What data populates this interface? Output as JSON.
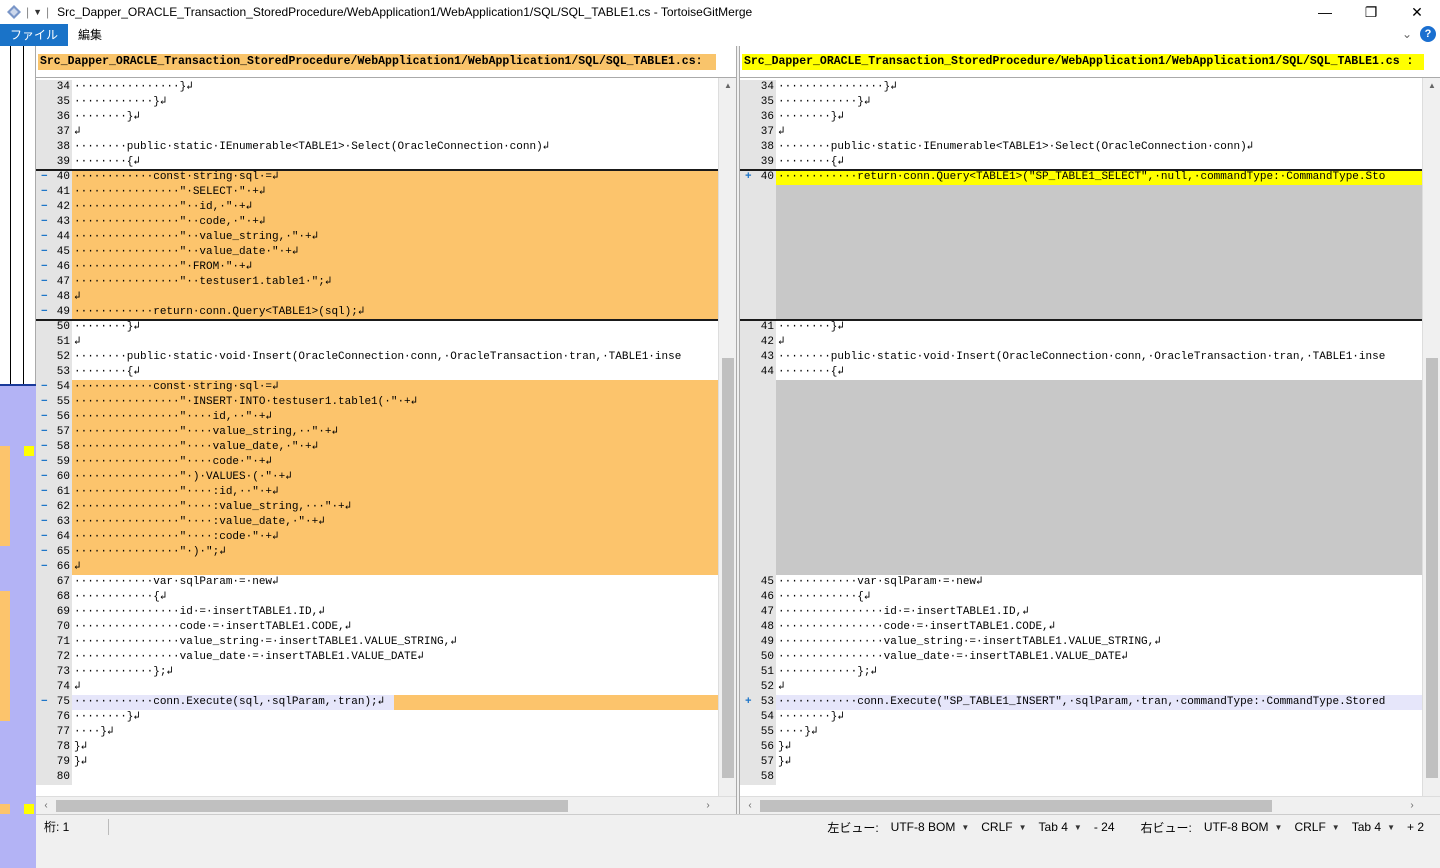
{
  "window": {
    "title": "Src_Dapper_ORACLE_Transaction_StoredProcedure/WebApplication1/WebApplication1/SQL/SQL_TABLE1.cs - TortoiseGitMerge",
    "minimize": "—",
    "maximize": "❐",
    "close": "✕"
  },
  "menu": {
    "file": "ファイル",
    "edit": "編集",
    "chevron_icon": "chevron-down-icon",
    "help_label": "?"
  },
  "left_pane": {
    "header": "Src_Dapper_ORACLE_Transaction_StoredProcedure/WebApplication1/WebApplication1/SQL/SQL_TABLE1.cs:",
    "lines": [
      {
        "num": "34",
        "mark": "",
        "type": "normal",
        "text": "················}↲"
      },
      {
        "num": "35",
        "mark": "",
        "type": "normal",
        "text": "············}↲"
      },
      {
        "num": "36",
        "mark": "",
        "type": "normal",
        "text": "········}↲"
      },
      {
        "num": "37",
        "mark": "",
        "type": "normal",
        "text": "↲"
      },
      {
        "num": "38",
        "mark": "",
        "type": "normal",
        "text": "········public·static·IEnumerable<TABLE1>·Select(OracleConnection·conn)↲"
      },
      {
        "num": "39",
        "mark": "",
        "type": "normal",
        "text": "········{↲"
      },
      {
        "num": "40",
        "mark": "−",
        "type": "removed",
        "text": "············const·string·sql·=↲"
      },
      {
        "num": "41",
        "mark": "−",
        "type": "removed",
        "text": "················\"·SELECT·\"·+↲"
      },
      {
        "num": "42",
        "mark": "−",
        "type": "removed",
        "text": "················\"··id,·\"·+↲"
      },
      {
        "num": "43",
        "mark": "−",
        "type": "removed",
        "text": "················\"··code,·\"·+↲"
      },
      {
        "num": "44",
        "mark": "−",
        "type": "removed",
        "text": "················\"··value_string,·\"·+↲"
      },
      {
        "num": "45",
        "mark": "−",
        "type": "removed",
        "text": "················\"··value_date·\"·+↲"
      },
      {
        "num": "46",
        "mark": "−",
        "type": "removed",
        "text": "················\"·FROM·\"·+↲"
      },
      {
        "num": "47",
        "mark": "−",
        "type": "removed",
        "text": "················\"··testuser1.table1·\";↲"
      },
      {
        "num": "48",
        "mark": "−",
        "type": "removed",
        "text": "↲"
      },
      {
        "num": "49",
        "mark": "−",
        "type": "removed",
        "text": "············return·conn.Query<TABLE1>(sql);↲"
      },
      {
        "num": "50",
        "mark": "",
        "type": "normal",
        "text": "········}↲"
      },
      {
        "num": "51",
        "mark": "",
        "type": "normal",
        "text": "↲"
      },
      {
        "num": "52",
        "mark": "",
        "type": "normal",
        "text": "········public·static·void·Insert(OracleConnection·conn,·OracleTransaction·tran,·TABLE1·inse"
      },
      {
        "num": "53",
        "mark": "",
        "type": "normal",
        "text": "········{↲"
      },
      {
        "num": "54",
        "mark": "−",
        "type": "removed",
        "text": "············const·string·sql·=↲"
      },
      {
        "num": "55",
        "mark": "−",
        "type": "removed",
        "text": "················\"·INSERT·INTO·testuser1.table1(·\"·+↲"
      },
      {
        "num": "56",
        "mark": "−",
        "type": "removed",
        "text": "················\"····id,··\"·+↲"
      },
      {
        "num": "57",
        "mark": "−",
        "type": "removed",
        "text": "················\"····value_string,··\"·+↲"
      },
      {
        "num": "58",
        "mark": "−",
        "type": "removed",
        "text": "················\"····value_date,·\"·+↲"
      },
      {
        "num": "59",
        "mark": "−",
        "type": "removed",
        "text": "················\"····code·\"·+↲"
      },
      {
        "num": "60",
        "mark": "−",
        "type": "removed",
        "text": "················\"·)·VALUES·(·\"·+↲"
      },
      {
        "num": "61",
        "mark": "−",
        "type": "removed",
        "text": "················\"····:id,··\"·+↲"
      },
      {
        "num": "62",
        "mark": "−",
        "type": "removed",
        "text": "················\"····:value_string,···\"·+↲"
      },
      {
        "num": "63",
        "mark": "−",
        "type": "removed",
        "text": "················\"····:value_date,·\"·+↲"
      },
      {
        "num": "64",
        "mark": "−",
        "type": "removed",
        "text": "················\"····:code·\"·+↲"
      },
      {
        "num": "65",
        "mark": "−",
        "type": "removed",
        "text": "················\"·)·\";↲"
      },
      {
        "num": "66",
        "mark": "−",
        "type": "removed",
        "text": "↲"
      },
      {
        "num": "67",
        "mark": "",
        "type": "normal",
        "text": "············var·sqlParam·=·new↲"
      },
      {
        "num": "68",
        "mark": "",
        "type": "normal",
        "text": "············{↲"
      },
      {
        "num": "69",
        "mark": "",
        "type": "normal",
        "text": "················id·=·insertTABLE1.ID,↲"
      },
      {
        "num": "70",
        "mark": "",
        "type": "normal",
        "text": "················code·=·insertTABLE1.CODE,↲"
      },
      {
        "num": "71",
        "mark": "",
        "type": "normal",
        "text": "················value_string·=·insertTABLE1.VALUE_STRING,↲"
      },
      {
        "num": "72",
        "mark": "",
        "type": "normal",
        "text": "················value_date·=·insertTABLE1.VALUE_DATE↲"
      },
      {
        "num": "73",
        "mark": "",
        "type": "normal",
        "text": "············};↲"
      },
      {
        "num": "74",
        "mark": "",
        "type": "normal",
        "text": "↲"
      },
      {
        "num": "75",
        "mark": "−",
        "type": "cursor-removed",
        "text": "············conn.Execute(sql,·sqlParam,·tran);↲"
      },
      {
        "num": "76",
        "mark": "",
        "type": "normal",
        "text": "········}↲"
      },
      {
        "num": "77",
        "mark": "",
        "type": "normal",
        "text": "····}↲"
      },
      {
        "num": "78",
        "mark": "",
        "type": "normal",
        "text": "}↲"
      },
      {
        "num": "79",
        "mark": "",
        "type": "normal",
        "text": "}↲"
      },
      {
        "num": "80",
        "mark": "",
        "type": "normal",
        "text": ""
      }
    ]
  },
  "right_pane": {
    "header": "Src_Dapper_ORACLE_Transaction_StoredProcedure/WebApplication1/WebApplication1/SQL/SQL_TABLE1.cs :",
    "lines": [
      {
        "num": "34",
        "mark": "",
        "type": "normal",
        "text": "················}↲"
      },
      {
        "num": "35",
        "mark": "",
        "type": "normal",
        "text": "············}↲"
      },
      {
        "num": "36",
        "mark": "",
        "type": "normal",
        "text": "········}↲"
      },
      {
        "num": "37",
        "mark": "",
        "type": "normal",
        "text": "↲"
      },
      {
        "num": "38",
        "mark": "",
        "type": "normal",
        "text": "········public·static·IEnumerable<TABLE1>·Select(OracleConnection·conn)↲"
      },
      {
        "num": "39",
        "mark": "",
        "type": "normal",
        "text": "········{↲"
      },
      {
        "num": "40",
        "mark": "+",
        "type": "added",
        "text": "············return·conn.Query<TABLE1>(\"SP_TABLE1_SELECT\",·null,·commandType:·CommandType.Sto"
      },
      {
        "num": "",
        "mark": "",
        "type": "empty",
        "text": ""
      },
      {
        "num": "",
        "mark": "",
        "type": "empty",
        "text": ""
      },
      {
        "num": "",
        "mark": "",
        "type": "empty",
        "text": ""
      },
      {
        "num": "",
        "mark": "",
        "type": "empty",
        "text": ""
      },
      {
        "num": "",
        "mark": "",
        "type": "empty",
        "text": ""
      },
      {
        "num": "",
        "mark": "",
        "type": "empty",
        "text": ""
      },
      {
        "num": "",
        "mark": "",
        "type": "empty",
        "text": ""
      },
      {
        "num": "",
        "mark": "",
        "type": "empty",
        "text": ""
      },
      {
        "num": "",
        "mark": "",
        "type": "empty",
        "text": ""
      },
      {
        "num": "41",
        "mark": "",
        "type": "normal",
        "text": "········}↲"
      },
      {
        "num": "42",
        "mark": "",
        "type": "normal",
        "text": "↲"
      },
      {
        "num": "43",
        "mark": "",
        "type": "normal",
        "text": "········public·static·void·Insert(OracleConnection·conn,·OracleTransaction·tran,·TABLE1·inse"
      },
      {
        "num": "44",
        "mark": "",
        "type": "normal",
        "text": "········{↲"
      },
      {
        "num": "",
        "mark": "",
        "type": "empty",
        "text": ""
      },
      {
        "num": "",
        "mark": "",
        "type": "empty",
        "text": ""
      },
      {
        "num": "",
        "mark": "",
        "type": "empty",
        "text": ""
      },
      {
        "num": "",
        "mark": "",
        "type": "empty",
        "text": ""
      },
      {
        "num": "",
        "mark": "",
        "type": "empty",
        "text": ""
      },
      {
        "num": "",
        "mark": "",
        "type": "empty",
        "text": ""
      },
      {
        "num": "",
        "mark": "",
        "type": "empty",
        "text": ""
      },
      {
        "num": "",
        "mark": "",
        "type": "empty",
        "text": ""
      },
      {
        "num": "",
        "mark": "",
        "type": "empty",
        "text": ""
      },
      {
        "num": "",
        "mark": "",
        "type": "empty",
        "text": ""
      },
      {
        "num": "",
        "mark": "",
        "type": "empty",
        "text": ""
      },
      {
        "num": "",
        "mark": "",
        "type": "empty",
        "text": ""
      },
      {
        "num": "",
        "mark": "",
        "type": "empty",
        "text": ""
      },
      {
        "num": "45",
        "mark": "",
        "type": "normal",
        "text": "············var·sqlParam·=·new↲"
      },
      {
        "num": "46",
        "mark": "",
        "type": "normal",
        "text": "············{↲"
      },
      {
        "num": "47",
        "mark": "",
        "type": "normal",
        "text": "················id·=·insertTABLE1.ID,↲"
      },
      {
        "num": "48",
        "mark": "",
        "type": "normal",
        "text": "················code·=·insertTABLE1.CODE,↲"
      },
      {
        "num": "49",
        "mark": "",
        "type": "normal",
        "text": "················value_string·=·insertTABLE1.VALUE_STRING,↲"
      },
      {
        "num": "50",
        "mark": "",
        "type": "normal",
        "text": "················value_date·=·insertTABLE1.VALUE_DATE↲"
      },
      {
        "num": "51",
        "mark": "",
        "type": "normal",
        "text": "············};↲"
      },
      {
        "num": "52",
        "mark": "",
        "type": "normal",
        "text": "↲"
      },
      {
        "num": "53",
        "mark": "+",
        "type": "cursor",
        "text": "············conn.Execute(\"SP_TABLE1_INSERT\",·sqlParam,·tran,·commandType:·CommandType.Stored"
      },
      {
        "num": "54",
        "mark": "",
        "type": "normal",
        "text": "········}↲"
      },
      {
        "num": "55",
        "mark": "",
        "type": "normal",
        "text": "····}↲"
      },
      {
        "num": "56",
        "mark": "",
        "type": "normal",
        "text": "}↲"
      },
      {
        "num": "57",
        "mark": "",
        "type": "normal",
        "text": "}↲"
      },
      {
        "num": "58",
        "mark": "",
        "type": "normal",
        "text": ""
      }
    ]
  },
  "status": {
    "column": "桁: 1",
    "left_view": "左ビュー:",
    "left_encoding": "UTF-8 BOM",
    "left_eol": "CRLF",
    "left_tab": "Tab 4",
    "left_diff": "- 24",
    "right_view": "右ビュー:",
    "right_encoding": "UTF-8 BOM",
    "right_eol": "CRLF",
    "right_tab": "Tab 4",
    "right_diff": "+ 2"
  },
  "colors": {
    "removed": "#fcc46c",
    "added": "#ffff00",
    "empty": "#c8c8c8",
    "cursor": "#e6e6fa",
    "accent": "#1a73c8"
  }
}
